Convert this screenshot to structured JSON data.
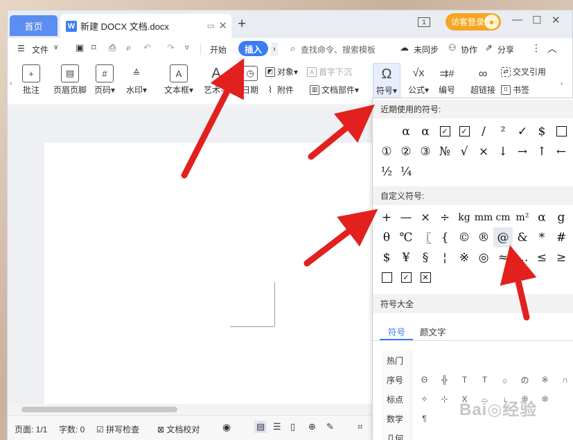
{
  "titlebar": {
    "home_tab": "首页",
    "doc_tab": "新建 DOCX 文档.docx",
    "doc_icon": "W",
    "window_count": "1",
    "login": "访客登录",
    "controls": [
      "—",
      "☐",
      "✕"
    ]
  },
  "menu": {
    "file": "文件",
    "start": "开始",
    "insert": "插入",
    "search_placeholder": "查找命令、搜索模板",
    "unsync": "未同步",
    "collab": "协作",
    "share": "分享"
  },
  "ribbon": {
    "comment": "批注",
    "header_footer": "页眉页脚",
    "page_num": "页码",
    "watermark": "水印",
    "textbox": "文本框",
    "wordart": "艺术字",
    "date": "日期",
    "object": "对象",
    "dropcap": "首字下沉",
    "attachment": "附件",
    "doc_parts": "文档部件",
    "symbol": "符号",
    "formula": "公式",
    "numbering": "编号",
    "hyperlink": "超链接",
    "cross_ref": "交叉引用",
    "bookmark": "书签"
  },
  "status": {
    "page": "页面: 1/1",
    "words": "字数: 0",
    "spellcheck": "拼写检查",
    "proofread": "文档校对"
  },
  "symbol_panel": {
    "recent_title": "近期使用的符号:",
    "recent_symbols": [
      "α",
      "α",
      "☑",
      "☑",
      "/",
      "²",
      "✓",
      "$",
      "☐",
      "①",
      "②",
      "③",
      "№",
      "√",
      "×",
      "↓",
      "→",
      "↑",
      "←",
      "½",
      "¼"
    ],
    "custom_title": "自定义符号:",
    "custom_symbols": [
      "+",
      "—",
      "×",
      "÷",
      "kg",
      "mm",
      "cm",
      "m²",
      "α",
      "g",
      "θ",
      "℃",
      "〖",
      "{",
      "©",
      "®",
      "@",
      "&",
      "*",
      "#",
      "$",
      "¥",
      "§",
      "¦",
      "※",
      "◎",
      "≈",
      "…",
      "≤",
      "≥",
      "☐",
      "☑",
      "☒"
    ],
    "all_title": "符号大全",
    "tabs": [
      "符号",
      "颜文字"
    ],
    "categories": [
      "热门",
      "序号",
      "标点",
      "数学",
      "几何"
    ],
    "big_symbols": [
      "",
      "",
      "",
      "",
      "",
      "",
      "",
      "",
      "Θ",
      "╬",
      "T",
      "T",
      "۞",
      "の",
      "※",
      "∩",
      "✧",
      "⊹",
      "X",
      "⌓",
      "↓",
      "❊",
      "❊",
      "",
      "¶",
      "",
      "",
      "",
      "",
      "",
      "",
      ""
    ]
  }
}
